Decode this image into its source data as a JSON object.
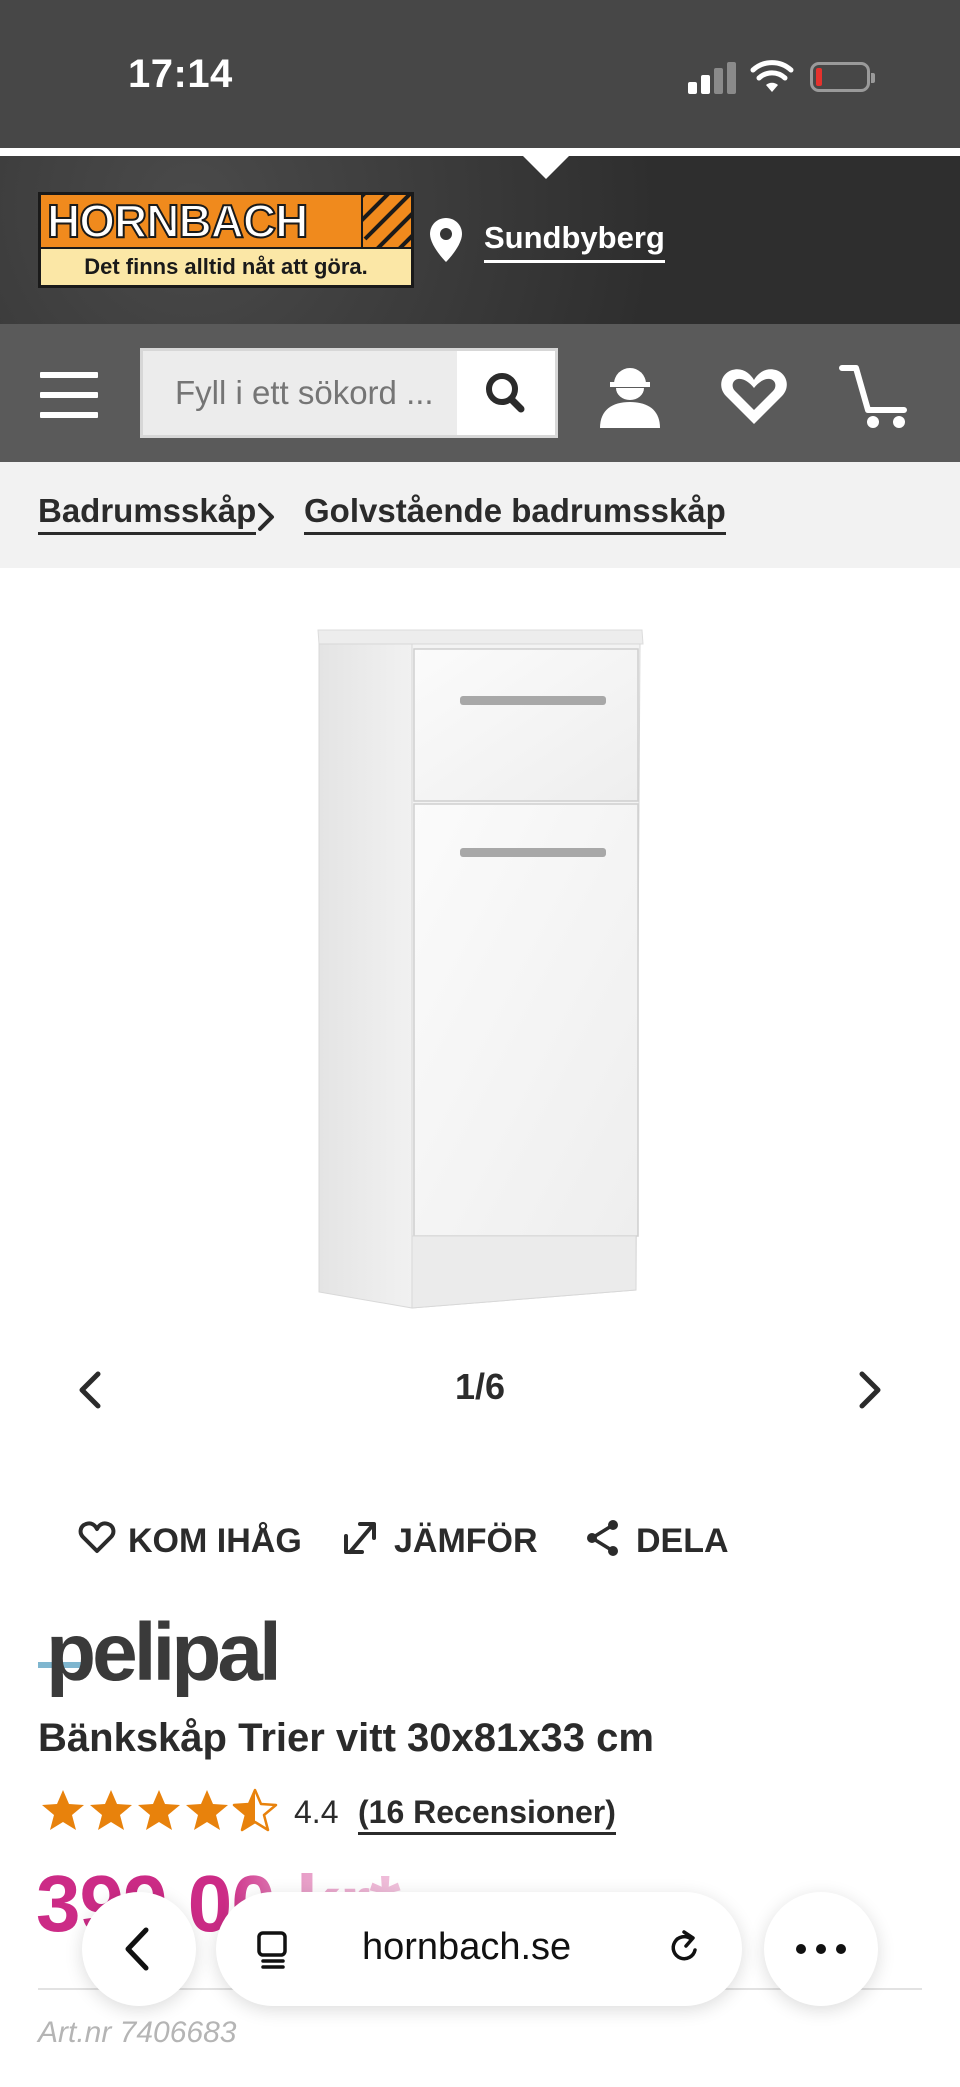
{
  "status_bar": {
    "time": "17:14"
  },
  "header": {
    "logo_text": "HORNBACH",
    "tagline": "Det finns alltid nåt att göra.",
    "location": "Sundbyberg"
  },
  "nav": {
    "search_placeholder": "Fyll i ett sökord ..."
  },
  "breadcrumb": {
    "items": [
      "Badrumsskåp",
      "Golvstående badrumsskåp"
    ]
  },
  "carousel": {
    "counter": "1/6"
  },
  "actions": {
    "remember": "KOM IHÅG",
    "compare": "JÄMFÖR",
    "share": "DELA"
  },
  "product": {
    "brand": "pelipal",
    "title": "Bänkskåp Trier vitt 30x81x33 cm",
    "rating": "4.4",
    "rating_stars": 4.4,
    "reviews": "(16 Recensioner)",
    "price": "399,00 kr*",
    "art_nr": "Art.nr 7406683"
  },
  "browser": {
    "url": "hornbach.se"
  },
  "colors": {
    "brand_orange": "#f08a1d",
    "price_magenta": "#cc2b86",
    "star_orange": "#e8820c",
    "nav_gray": "#5a5a5a"
  }
}
